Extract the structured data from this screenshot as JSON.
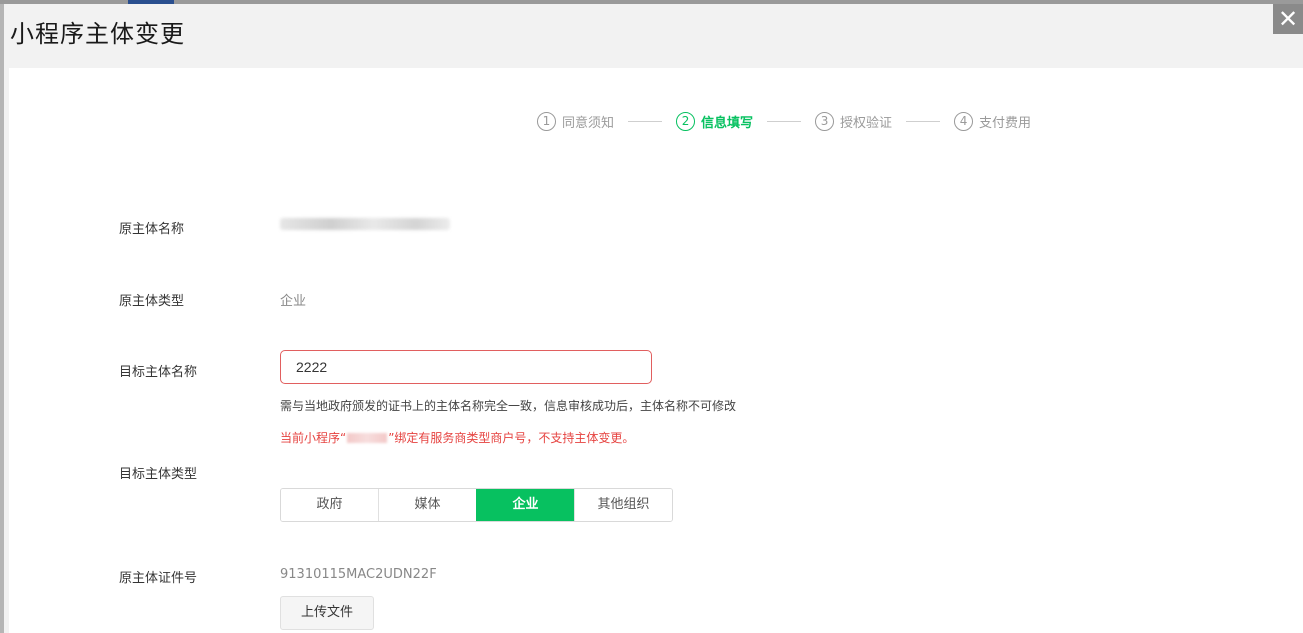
{
  "dialog": {
    "title": "小程序主体变更",
    "close_glyph": "✕",
    "close_icon": "close-icon"
  },
  "steps": [
    {
      "num": "1",
      "label": "同意须知",
      "active": false
    },
    {
      "num": "2",
      "label": "信息填写",
      "active": true
    },
    {
      "num": "3",
      "label": "授权验证",
      "active": false
    },
    {
      "num": "4",
      "label": "支付费用",
      "active": false
    }
  ],
  "form": {
    "orig_name_label": "原主体名称",
    "orig_type_label": "原主体类型",
    "orig_type_value": "企业",
    "target_name_label": "目标主体名称",
    "target_name_value": "2222",
    "target_name_hint": "需与当地政府颁发的证书上的主体名称完全一致，信息审核成功后，主体名称不可修改",
    "error_prefix": "当前小程序“",
    "error_suffix": "”绑定有服务商类型商户号，不支持主体变更。",
    "target_type_label": "目标主体类型",
    "target_type_options": [
      "政府",
      "媒体",
      "企业",
      "其他组织"
    ],
    "target_type_selected": "企业",
    "cert_label": "原主体证件号",
    "cert_value": "91310115MAC2UDN22F",
    "upload_label": "上传文件"
  },
  "colors": {
    "accent": "#07c160",
    "error": "#e64340",
    "input_border_error": "#e15f5f"
  }
}
